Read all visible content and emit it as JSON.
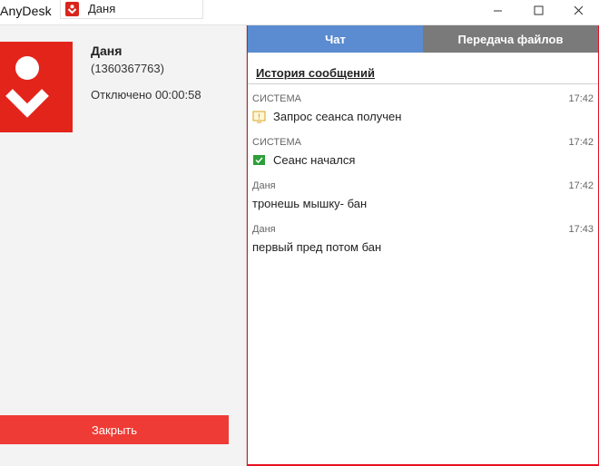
{
  "window": {
    "app_name": "AnyDesk",
    "tab_label": "Даня",
    "minimize_icon": "minimize-icon",
    "maximize_icon": "maximize-icon",
    "close_icon": "close-icon"
  },
  "session": {
    "name": "Даня",
    "id": "(1360367763)",
    "status": "Отключено 00:00:58",
    "close_label": "Закрыть"
  },
  "tabs": {
    "chat": "Чат",
    "files": "Передача файлов"
  },
  "history": {
    "title": "История сообщений",
    "messages": [
      {
        "sender": "СИСТЕМА",
        "time": "17:42",
        "text": "Запрос сеанса получен",
        "icon": "session-request-icon"
      },
      {
        "sender": "СИСТЕМА",
        "time": "17:42",
        "text": "Сеанс начался",
        "icon": "session-started-icon"
      },
      {
        "sender": "Даня",
        "time": "17:42",
        "text": "тронешь мышку- бан"
      },
      {
        "sender": "Даня",
        "time": "17:43",
        "text": "первый пред потом бан"
      }
    ]
  },
  "colors": {
    "brand_red": "#e3241b",
    "tab_active": "#5b8bd0",
    "tab_inactive": "#7a7a7a",
    "close_button": "#ef3b35",
    "desktop": "#e81123"
  }
}
